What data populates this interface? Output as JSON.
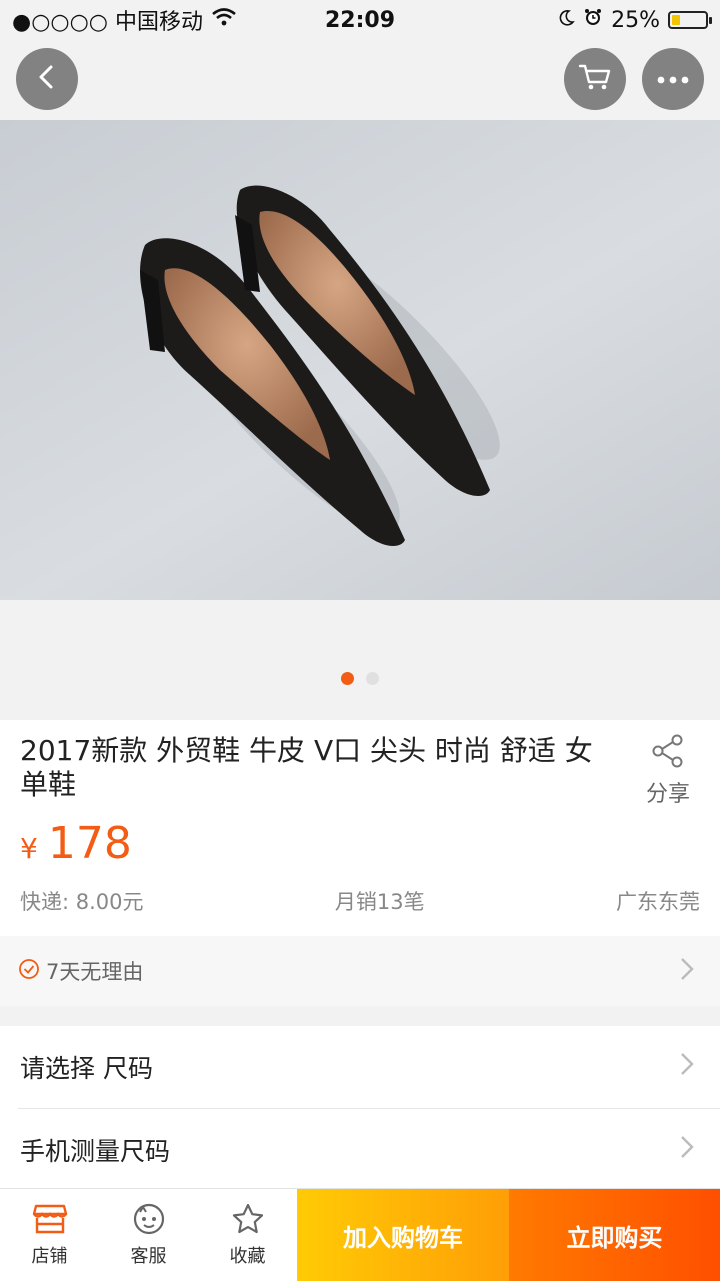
{
  "status_bar": {
    "carrier": "●○○○○ 中国移动",
    "time": "22:09",
    "battery": "25%",
    "battery_level": 0.25
  },
  "nav": {
    "back_icon": "back-arrow-icon",
    "cart_icon": "cart-icon",
    "more_icon": "more-dots-icon"
  },
  "carousel": {
    "count": 2,
    "active_index": 0
  },
  "product": {
    "title": "2017新款 外贸鞋 牛皮 V口 尖头 时尚 舒适 女单鞋",
    "price_symbol": "¥",
    "price": "178",
    "shipping": "快递: 8.00元",
    "monthly_sales": "月销13笔",
    "location": "广东东莞"
  },
  "share": {
    "label": "分享"
  },
  "service": {
    "text": "7天无理由"
  },
  "options": {
    "size_label": "请选择 尺码",
    "measure_label": "手机测量尺码"
  },
  "bottom_bar": {
    "shop_label": "店铺",
    "service_label": "客服",
    "favorite_label": "收藏",
    "add_cart_label": "加入购物车",
    "buy_now_label": "立即购买"
  },
  "colors": {
    "accent": "#f25c14",
    "cart_button": "#ffb400",
    "buy_button": "#ff5a00"
  }
}
